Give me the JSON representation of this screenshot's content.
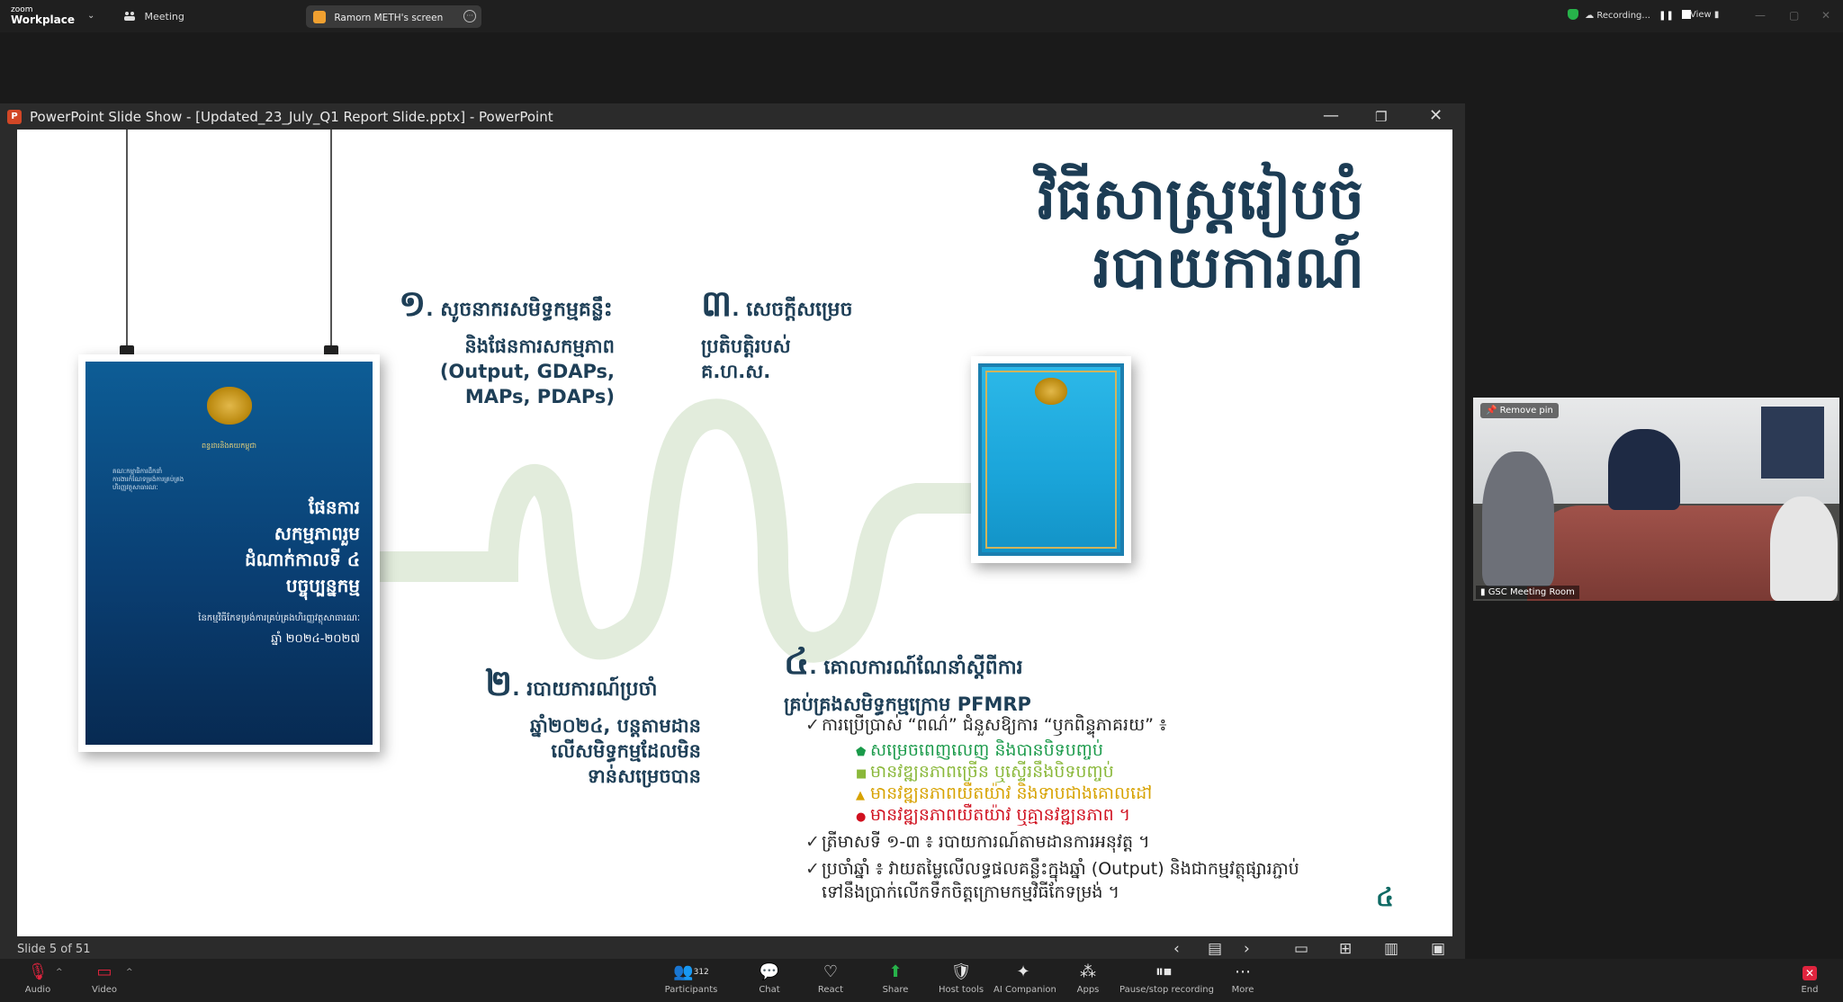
{
  "zoom": {
    "brand_top": "zoom",
    "brand_bottom": "Workplace",
    "meeting_label": "Meeting",
    "share_tab": "Ramorn METH's screen",
    "recording": "Recording...",
    "view": "View"
  },
  "powerpoint": {
    "window_title": "PowerPoint Slide Show - [Updated_23_July_Q1 Report Slide.pptx] - PowerPoint",
    "app_letter": "P",
    "slide_status": "Slide 5 of 51"
  },
  "slide": {
    "title_line1": "វិធីសាស្រ្តរៀបចំ",
    "title_line2": "របាយការណ៍",
    "step1": {
      "num": "១",
      "label": ". សូចនាករសមិទ្ធកម្មគន្លឹះ",
      "body": [
        "និងផែនការសកម្មភាព",
        "(Output, GDAPs,",
        "MAPs, PDAPs)"
      ]
    },
    "step2": {
      "num": "២",
      "label": ". របាយការណ៍ប្រចាំ",
      "body": [
        "ឆ្នាំ២០២៤, បន្តតាមដាន",
        "លើសមិទ្ធកម្មដែលមិន",
        "ទាន់សម្រេចបាន"
      ]
    },
    "step3": {
      "num": "៣",
      "label": ". សេចក្តីសម្រេច",
      "body": [
        "ប្រតិបត្តិរបស់",
        "គ.ហ.ស."
      ]
    },
    "step4": {
      "num": "៤",
      "label": ". គោលការណ៍ណែនាំស្តីពីការ",
      "body": [
        "គ្រប់គ្រងសមិទ្ធកម្មក្រោម PFMRP"
      ]
    },
    "list": {
      "line1": "ការប្រើប្រាស់ “ពណ៌” ជំនួសឱ្យការ “ឫកពិន្ទុភាគរយ” ៖",
      "green_dark": "សម្រេចពេញលេញ និងបានបិទបញ្ចប់",
      "green_light": "មានវឌ្ឍនភាពច្រើន ឬស្ទើរនឹងបិទបញ្ចប់",
      "yellow": "មានវឌ្ឍនភាពយឺតយ៉ាវ និងទាបជាងគោលដៅ",
      "red": "មានវឌ្ឍនភាពយឺតយ៉ាវ ឬគ្មានវឌ្ឍនភាព ។",
      "line2": "ត្រីមាសទី ១-៣ ៖ របាយការណ៍តាមដានការអនុវត្ត ។",
      "line3a": "ប្រចាំឆ្នាំ ៖ វាយតម្លៃលើលទ្ធផលគន្លឹះក្នុងឆ្នាំ (Output) និងជាកម្មវត្ថុផ្សារភ្ជាប់",
      "line3b": "ទៅនឹងប្រាក់លើកទឹកចិត្តក្រោមកម្មវិធីកែទម្រង់ ។"
    },
    "page_number": "៤",
    "poster1": {
      "ministry": "ពន្ធដារនិងគយកម្ពុជា",
      "small_lines": [
        "គណៈកម្មាធិការដឹកនាំ",
        "ការងារកំណែទម្រង់ការគ្រប់គ្រង",
        "ហិរញ្ញវត្ថុសាធារណៈ"
      ],
      "big_lines": [
        "ផែនការ",
        "សកម្មភាពរួម",
        "ដំណាក់កាលទី ៤",
        "បច្ចុប្បន្នកម្ម"
      ],
      "sub": "នៃកម្មវិធីកែទម្រង់ការគ្រប់គ្រងហិរញ្ញវត្ថុសាធារណៈ",
      "years": "ឆ្នាំ ២០២៤-២០២៧"
    },
    "colors": {
      "green_dark": "#1a9a4a",
      "green_light": "#8ab83a",
      "yellow": "#d7a200",
      "red": "#d0101f",
      "heading": "#1c3c54",
      "road": "#e2ecdc"
    }
  },
  "video": {
    "pin_label": "Remove pin",
    "room_name": "GSC Meeting Room"
  },
  "toolbar": {
    "audio": "Audio",
    "video": "Video",
    "participants": "Participants",
    "participants_count": "312",
    "chat": "Chat",
    "react": "React",
    "share": "Share",
    "host_tools": "Host tools",
    "ai_companion": "AI Companion",
    "apps": "Apps",
    "pause_recording": "Pause/stop recording",
    "more": "More",
    "end": "End"
  }
}
